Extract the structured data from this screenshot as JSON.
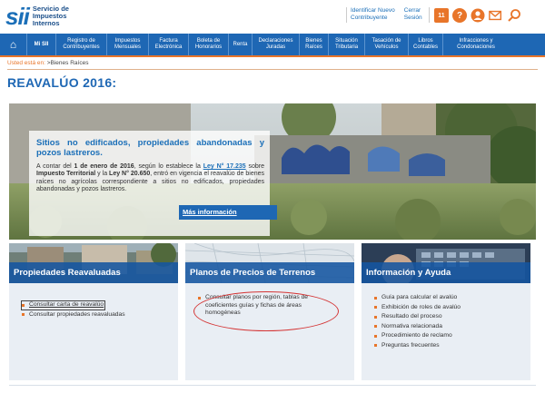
{
  "header": {
    "logo_mark": "sii",
    "logo_text_1": "Servicio de",
    "logo_text_2": "Impuestos",
    "logo_text_3": "Internos",
    "link_1a": "Identificar Nuevo",
    "link_1b": "Contribuyente",
    "link_2a": "Cerrar",
    "link_2b": "Sesión",
    "calendar_day": "11",
    "icons": [
      "calendar-icon",
      "help-icon",
      "person-icon",
      "mail-icon",
      "search-icon"
    ]
  },
  "nav": {
    "home_icon": "⌂",
    "items": [
      {
        "l1": "Mi SII",
        "l2": ""
      },
      {
        "l1": "Registro de",
        "l2": "Contribuyentes"
      },
      {
        "l1": "Impuestos",
        "l2": "Mensuales"
      },
      {
        "l1": "Factura",
        "l2": "Electrónica"
      },
      {
        "l1": "Boleta de",
        "l2": "Honorarios"
      },
      {
        "l1": "Renta",
        "l2": ""
      },
      {
        "l1": "Declaraciones",
        "l2": "Juradas"
      },
      {
        "l1": "Bienes",
        "l2": "Raíces"
      },
      {
        "l1": "Situación",
        "l2": "Tributaria"
      },
      {
        "l1": "Tasación de",
        "l2": "Vehículos"
      },
      {
        "l1": "Libros",
        "l2": "Contables"
      },
      {
        "l1": "Infracciones y",
        "l2": "Condonaciones"
      }
    ]
  },
  "breadcrumb": {
    "label": "Usted está en:",
    "path": ">Bienes Raíces"
  },
  "page_title": "REAVALÚO 2016:",
  "hero": {
    "title": "Sitios no edificados, propiedades abandonadas y pozos lastreros.",
    "t1": "A contar del ",
    "t2": "1 de enero de 2016",
    "t3": ", según lo establece la ",
    "t4": "Ley N° 17.235",
    "t5": " sobre ",
    "t6": "Impuesto Territorial",
    "t7": " y la ",
    "t8": "Ley N° 20.650",
    "t9": ", entró en vigencia el reavalúo de bienes raíces no agrícolas correspondiente a sitios no edificados, propiedades abandonadas y pozos lastreros.",
    "button": "Más información"
  },
  "cards": [
    {
      "title": "Propiedades Reavaluadas",
      "items": [
        "Consultar carta de reavalúo",
        "Consultar propiedades reavaluadas"
      ]
    },
    {
      "title": "Planos de Precios de Terrenos",
      "items": [
        "Consultar planos por región, tablas de coeficientes guías y fichas de áreas homogéneas"
      ]
    },
    {
      "title": "Información y Ayuda",
      "items": [
        "Guía para calcular el avalúo",
        "Exhibición de roles de avalúo",
        "Resultado del proceso",
        "Normativa relacionada",
        "Procedimiento de reclamo",
        "Preguntas frecuentes"
      ]
    }
  ]
}
